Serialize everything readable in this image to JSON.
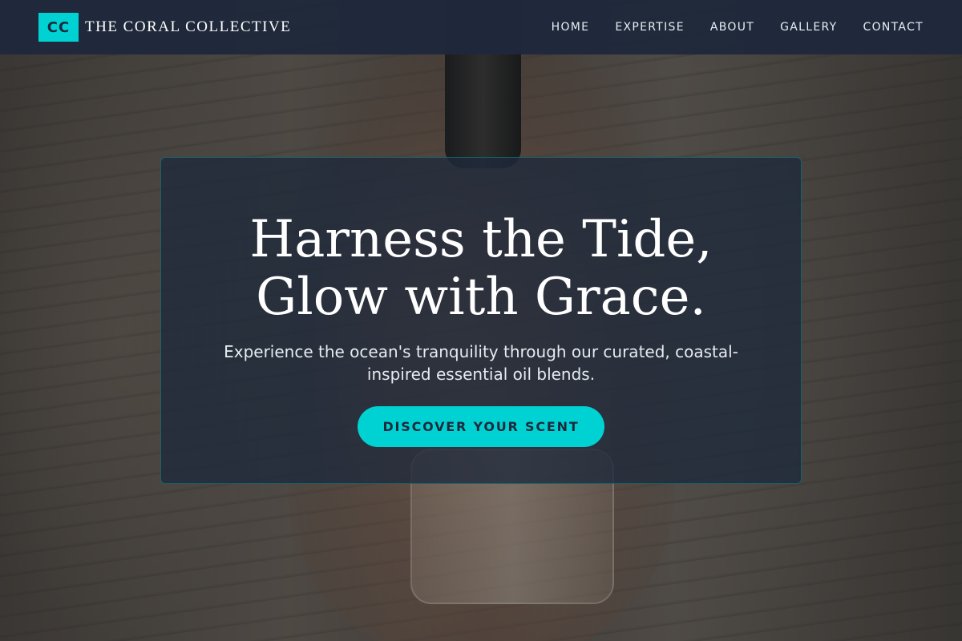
{
  "brand": {
    "logo_text": "CC",
    "name": "THE CORAL COLLECTIVE",
    "accent_color": "#00d2d3"
  },
  "nav": {
    "items": [
      {
        "label": "HOME"
      },
      {
        "label": "EXPERTISE"
      },
      {
        "label": "ABOUT"
      },
      {
        "label": "GALLERY"
      },
      {
        "label": "CONTACT"
      }
    ]
  },
  "hero": {
    "title_line1": "Harness the Tide,",
    "title_line2": "Glow with Grace.",
    "subtitle": "Experience the ocean's tranquility through our curated, coastal-inspired essential oil blends.",
    "cta_label": "DISCOVER YOUR SCENT"
  },
  "colors": {
    "header_bg": "#1e293b",
    "card_bg": "#1e293b",
    "accent": "#00d2d3"
  }
}
